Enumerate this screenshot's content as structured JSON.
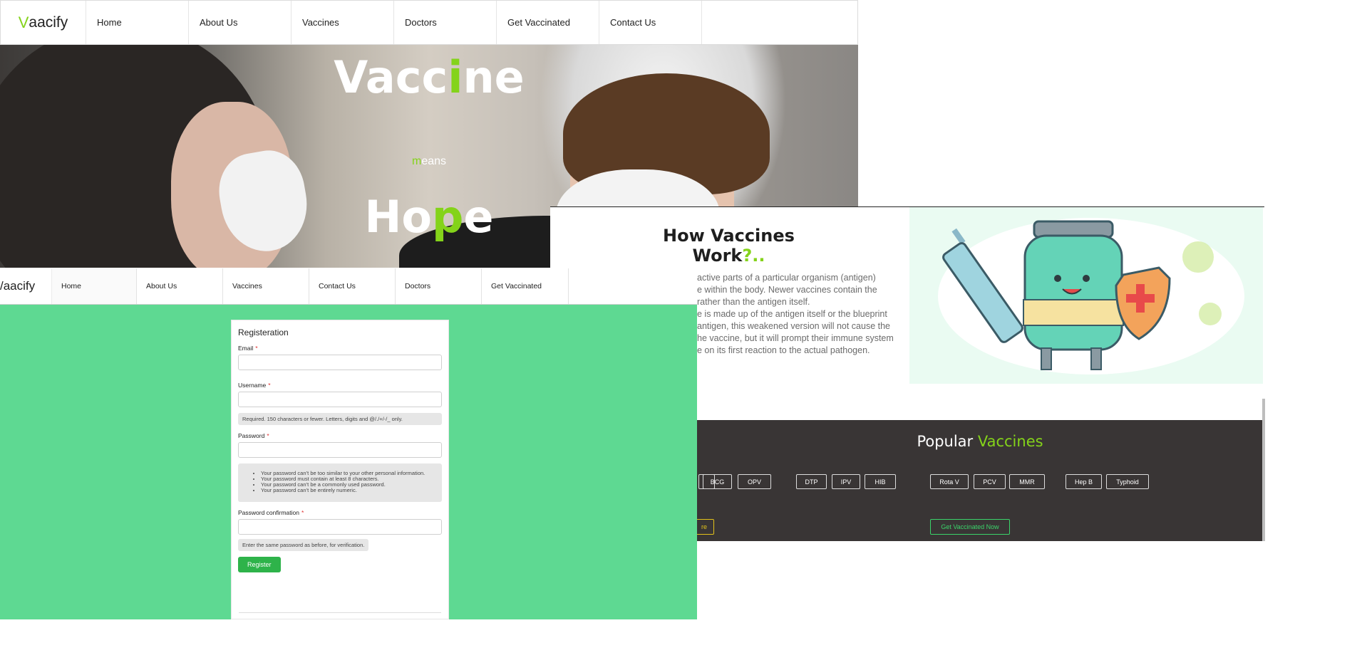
{
  "nav_top": {
    "brand_first": "V",
    "brand_rest": "aacify",
    "items": [
      "Home",
      "About Us",
      "Vaccines",
      "Doctors",
      "Get Vaccinated",
      "Contact Us"
    ]
  },
  "hero": {
    "title_a": "Vacc",
    "title_b": "i",
    "title_c": "ne",
    "mid_a": "m",
    "mid_b": "eans",
    "hope_a": "Ho",
    "hope_b": "p",
    "hope_c": "e"
  },
  "nav_second": {
    "brand": "/aacify",
    "items": [
      "Home",
      "About Us",
      "Vaccines",
      "Contact Us",
      "Doctors",
      "Get Vaccinated"
    ]
  },
  "registration": {
    "heading": "Registeration",
    "email_label": "Email",
    "username_label": "Username",
    "username_help": "Required. 150 characters or fewer. Letters, digits and @/./+/-/_ only.",
    "password_label": "Password",
    "password_help": [
      "Your password can’t be too similar to your other personal information.",
      "Your password must contain at least 8 characters.",
      "Your password can’t be a commonly used password.",
      "Your password can’t be entirely numeric."
    ],
    "confirm_label": "Password confirmation",
    "confirm_help": "Enter the same password as before, for verification.",
    "required_mark": "*",
    "register_button": "Register"
  },
  "how_work": {
    "title": "How Vaccines Work",
    "title_mark": "?..",
    "lines": [
      "active parts of a particular organism (antigen)",
      "e within the body. Newer vaccines contain the",
      "rather than the antigen itself.",
      "e is made up of the antigen itself or the blueprint",
      "antigen, this weakened version will not cause the",
      "he vaccine, but it will prompt their immune system",
      "e on its first reaction to the actual pathogen."
    ]
  },
  "popular": {
    "title_a": "Popular ",
    "title_b": "Vaccines",
    "chips": [
      "BCG",
      "OPV",
      "DTP",
      "IPV",
      "HIB",
      "Rota V",
      "PCV",
      "MMR",
      "Hep B",
      "Typhoid"
    ],
    "more_button": "re",
    "get_vaccinated_button": "Get Vaccinated Now"
  },
  "colors": {
    "accent_green": "#84d31a",
    "page_green": "#5ed992",
    "dark_section": "#393535",
    "button_green": "#2eb34a",
    "more_button_yellow": "#e3c21a"
  }
}
